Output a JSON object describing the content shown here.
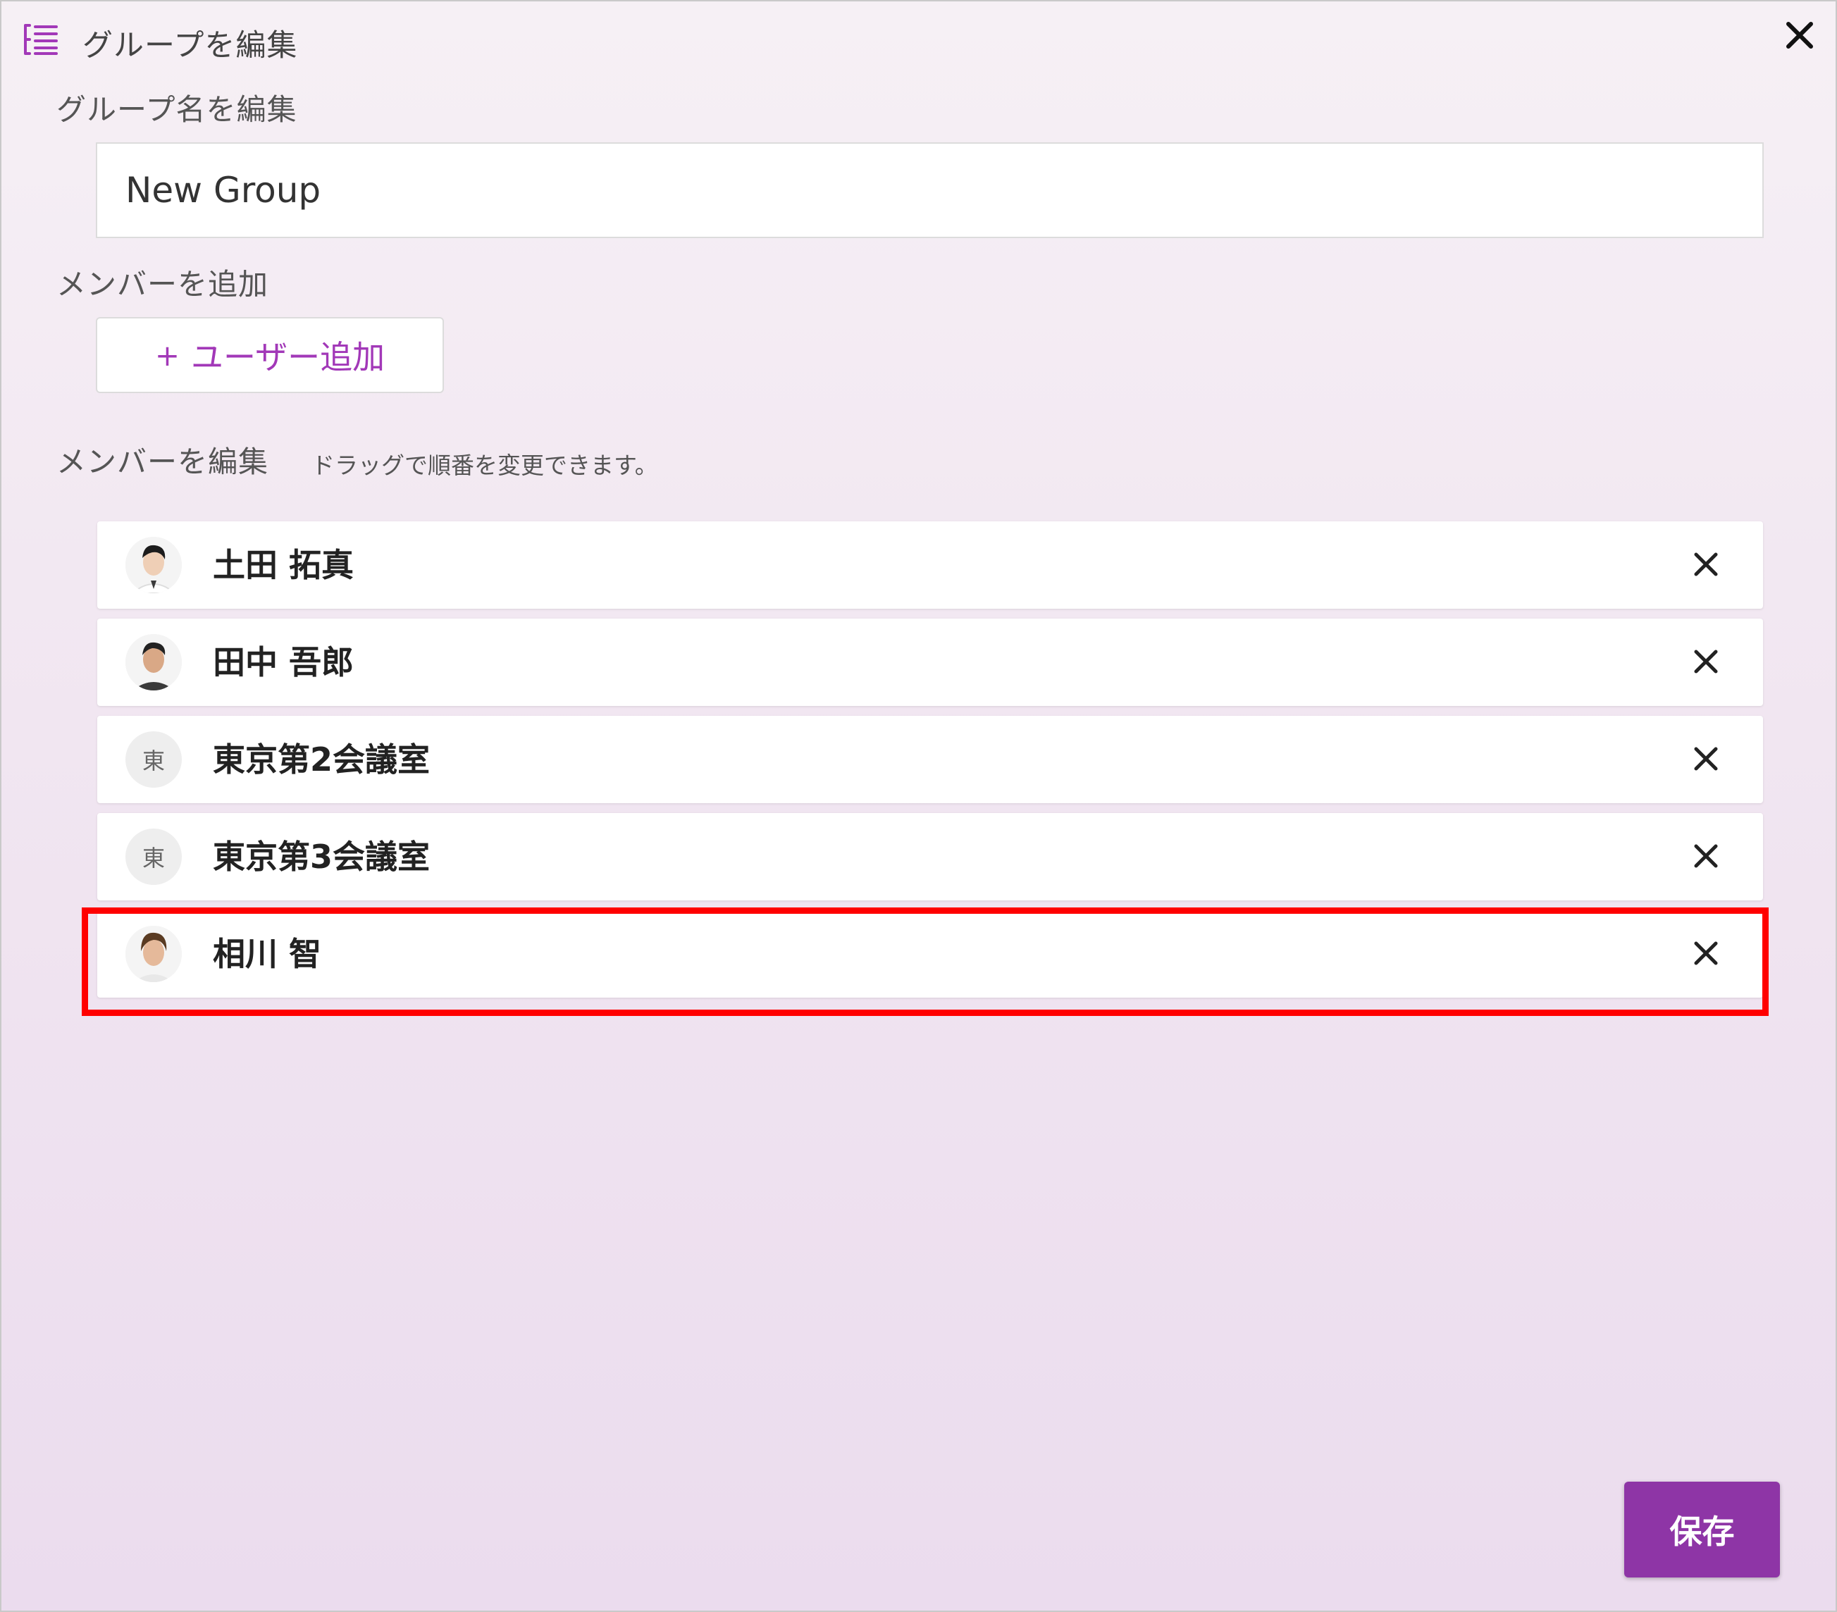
{
  "header": {
    "title": "グループを編集",
    "icon": "list-icon",
    "close_icon": "close-icon"
  },
  "group_name": {
    "label": "グループ名を編集",
    "value": "New Group"
  },
  "add_member": {
    "label": "メンバーを追加",
    "plus": "+",
    "button_label": "ユーザー追加"
  },
  "edit_members": {
    "label": "メンバーを編集",
    "hint": "ドラッグで順番を変更できます。",
    "members": [
      {
        "name": "土田 拓真",
        "avatar": "photo"
      },
      {
        "name": "田中 吾郎",
        "avatar": "photo"
      },
      {
        "name": "東京第2会議室",
        "avatar": "initial",
        "initial": "東"
      },
      {
        "name": "東京第3会議室",
        "avatar": "initial",
        "initial": "東"
      },
      {
        "name": "相川 智",
        "avatar": "photo"
      }
    ]
  },
  "footer": {
    "save_label": "保存"
  },
  "colors": {
    "accent": "#8e35a6",
    "link": "#a238b8",
    "highlight": "#ff0000"
  }
}
